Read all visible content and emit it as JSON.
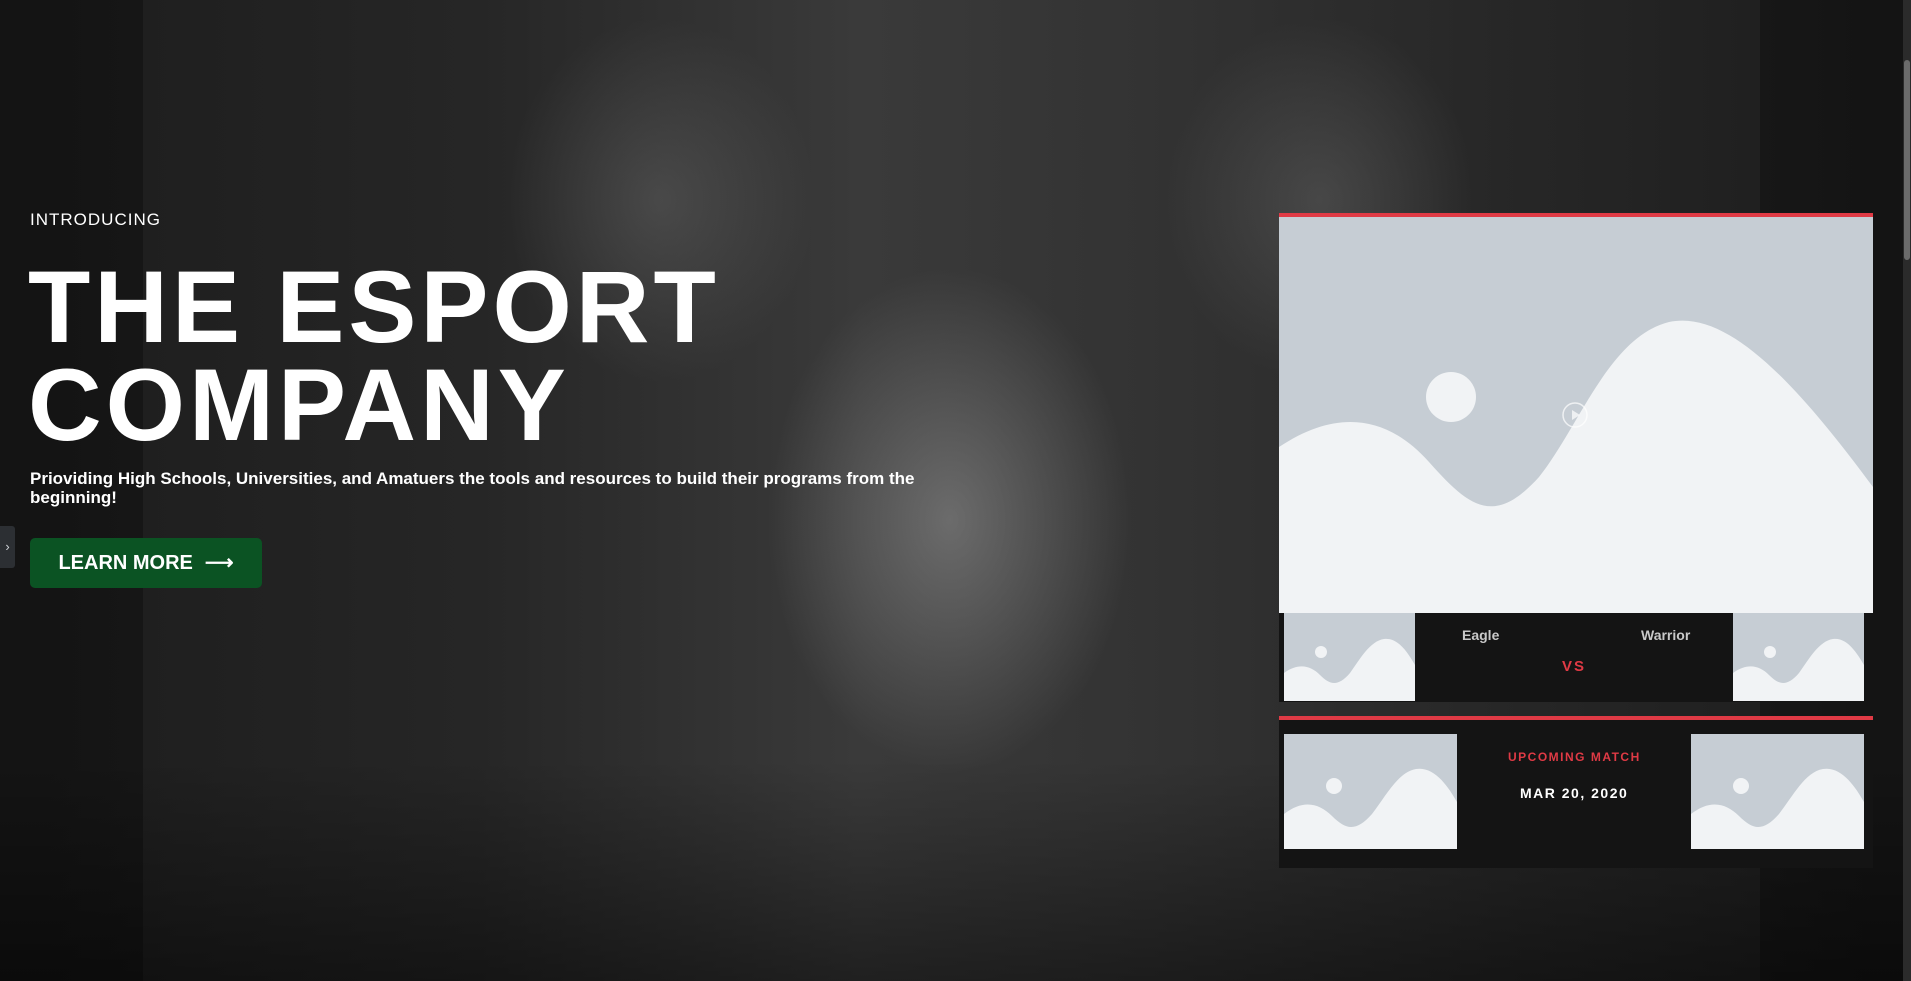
{
  "hero": {
    "eyebrow": "INTRODUCING",
    "title_line1": "THE ESPORT",
    "title_line2": "COMPANY",
    "subtitle": "Prioviding High Schools, Universities, and Amatuers the tools and resources to build their programs from the beginning!",
    "cta_label": "LEARN MORE",
    "cta_icon": "arrow-right-icon"
  },
  "sidebar_toggle": {
    "icon": "chevron-right-icon",
    "glyph": "›"
  },
  "featured_match": {
    "team_left": "Eagle",
    "team_right": "Warrior",
    "vs_label": "VS"
  },
  "upcoming_match": {
    "label": "UPCOMING MATCH",
    "date": "MAR 20, 2020"
  },
  "colors": {
    "accent_red": "#e03a45",
    "cta_green": "#0b5323",
    "placeholder_bg": "#c6cdd4",
    "placeholder_fg": "#f1f3f5",
    "panel_dark": "#141414"
  }
}
